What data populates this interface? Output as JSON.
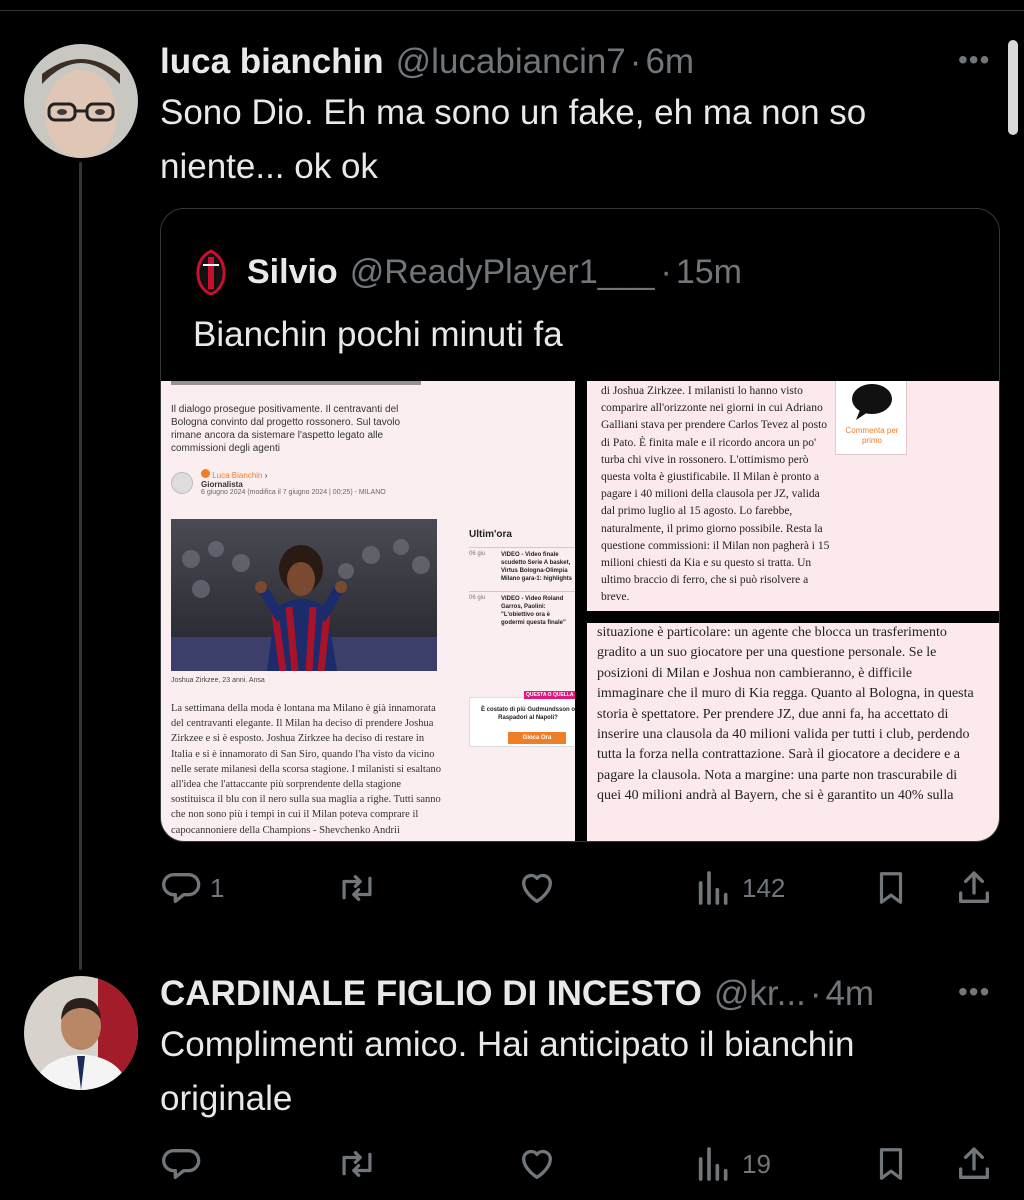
{
  "tweet1": {
    "name": "luca bianchin",
    "handle": "@lucabiancin7",
    "time": "6m",
    "text_line1": "Sono Dio. Eh ma sono un fake, eh ma non so",
    "text_line2": "niente... ok ok",
    "stats": {
      "replies": "1",
      "views": "142"
    }
  },
  "quote": {
    "name": "Silvio",
    "handle": "@ReadyPlayer1___",
    "time": "15m",
    "text": "Bianchin pochi minuti fa",
    "left_image": {
      "intro": "Il dialogo prosegue positivamente. Il centravanti del Bologna convinto dal progetto rossonero. Sul tavolo rimane ancora da sistemare l'aspetto legato alle commissioni degli agenti",
      "author": "Luca Bianchin",
      "author_role": "Giornalista",
      "date": "6 giugno 2024 (modifica il 7 giugno 2024 | 00:25) - MILANO",
      "caption": "Joshua Zirkzee, 23 anni. Ansa",
      "ultimora": "Ultim'ora",
      "news": [
        {
          "date": "06 giu",
          "text": "VIDEO - Video finale scudetto Serie A basket, Virtus Bologna-Olimpia Milano gara-1: highlights"
        },
        {
          "date": "06 giu",
          "text": "VIDEO - Video Roland Garros, Paolini: \"L'obiettivo ora è godermi questa finale\""
        }
      ],
      "ad_text": "È costato di più Gudmundsson o Raspadori al Napoli?",
      "ad_button": "Gioca Ora",
      "ad_badge": "QUESTA O QUELLA",
      "body": "La settimana della moda è lontana ma Milano è già innamorata del centravanti elegante. Il Milan ha deciso di prendere Joshua Zirkzee e si è esposto. Joshua Zirkzee ha deciso di restare in Italia e si è innamorato di San Siro, quando l'ha visto da vicino nelle serate milanesi della scorsa stagione. I milanisti si esaltano all'idea che l'attaccante più sorprendente della stagione sostituisca il blu con il nero sulla sua maglia a righe. Tutti sanno che non sono più i tempi in cui il Milan poteva comprare il capocannoniere della Champions - Shevchenko Andrii"
    },
    "right_top_image": {
      "text": "di Joshua Zirkzee. I milanisti lo hanno visto comparire all'orizzonte nei giorni in cui Adriano Galliani stava per prendere Carlos Tevez al posto di Pato. È finita male e il ricordo ancora un po' turba chi vive in rossonero. L'ottimismo però questa volta è giustificabile. Il Milan è pronto a pagare i 40 milioni della clausola per JZ, valida dal primo luglio al 15 agosto. Lo farebbe, naturalmente, il primo giorno possibile. Resta la questione commissioni: il Milan non pagherà i 15 milioni chiesti da Kia e su questo si tratta. Un ultimo braccio di ferro, che si può risolvere a breve.",
      "comment_label": "Commenta per primo"
    },
    "right_bottom_image": {
      "text": "situazione è particolare: un agente che blocca un trasferimento gradito a un suo giocatore per una questione personale. Se le posizioni di Milan e Joshua non cambieranno, è difficile immaginare che il muro di Kia regga. Quanto al Bologna, in questa storia è spettatore. Per prendere JZ, due anni fa, ha accettato di inserire una clausola da 40 milioni valida per tutti i club, perdendo tutta la forza nella contrattazione. Sarà il giocatore a decidere e a pagare la clausola. Nota a margine: una parte non trascurabile di quei 40 milioni andrà al Bayern, che si è garantito un 40% sulla"
    }
  },
  "tweet2": {
    "name": "CARDINALE FIGLIO DI INCESTO",
    "handle": "@kr...",
    "time": "4m",
    "text_line1": "Complimenti amico. Hai anticipato il bianchin",
    "text_line2": "originale",
    "stats": {
      "views": "19"
    }
  },
  "icons": [
    "more-icon",
    "reply-icon",
    "retweet-icon",
    "like-icon",
    "views-icon",
    "bookmark-icon",
    "share-icon"
  ],
  "colors": {
    "background": "#000000",
    "text": "#e7e9ea",
    "muted": "#71767b",
    "border": "#2f3336",
    "article_bg": "#fbe9ec",
    "accent_orange": "#f07d2a"
  }
}
